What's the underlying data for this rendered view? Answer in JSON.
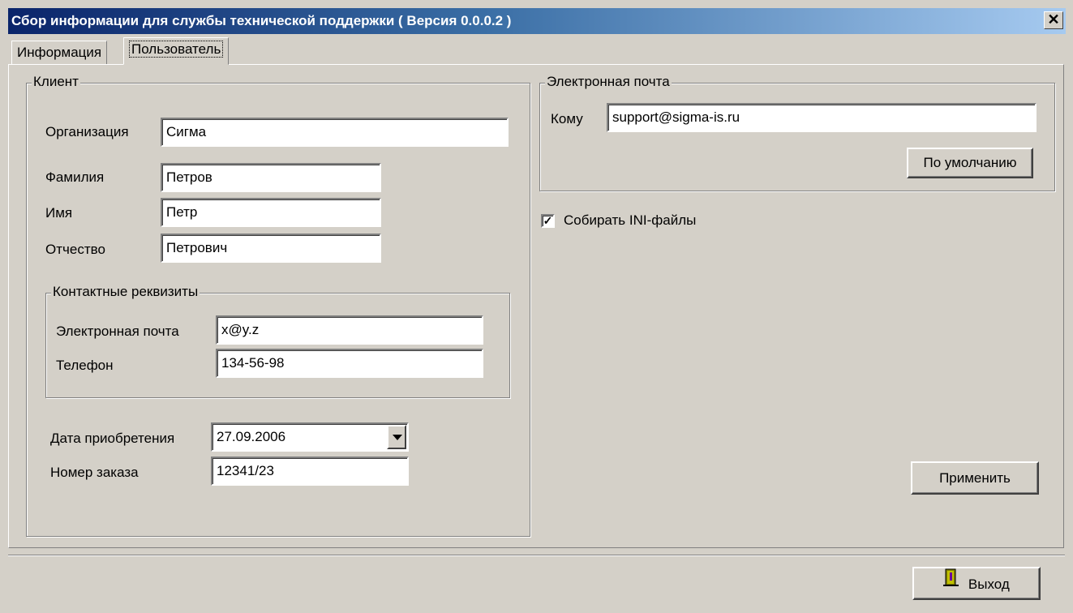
{
  "window": {
    "title": "Сбор информации для службы технической поддержки ( Версия 0.0.0.2 )",
    "close_glyph": "✕"
  },
  "tabs": [
    {
      "label": "Информация",
      "active": false
    },
    {
      "label": "Пользователь",
      "active": true
    }
  ],
  "client": {
    "group_label": "Клиент",
    "organization": {
      "label": "Организация",
      "value": "Сигма"
    },
    "last_name": {
      "label": "Фамилия",
      "value": "Петров"
    },
    "first_name": {
      "label": "Имя",
      "value": "Петр"
    },
    "patronymic": {
      "label": "Отчество",
      "value": "Петрович"
    },
    "contacts": {
      "group_label": "Контактные реквизиты",
      "email": {
        "label": "Электронная почта",
        "value": "x@y.z"
      },
      "phone": {
        "label": "Телефон",
        "value": "134-56-98"
      }
    },
    "purchase_date": {
      "label": "Дата приобретения",
      "value": "27.09.2006"
    },
    "order_number": {
      "label": "Номер заказа",
      "value": "12341/23"
    }
  },
  "email_settings": {
    "group_label": "Электронная почта",
    "to": {
      "label": "Кому",
      "value": "support@sigma-is.ru"
    },
    "default_button": "По умолчанию"
  },
  "collect_ini": {
    "label": "Собирать INI-файлы",
    "checked": true,
    "mark": "✓"
  },
  "apply_button": "Применить",
  "exit_button": "Выход",
  "icons": {
    "exit": "door-exit-icon"
  }
}
